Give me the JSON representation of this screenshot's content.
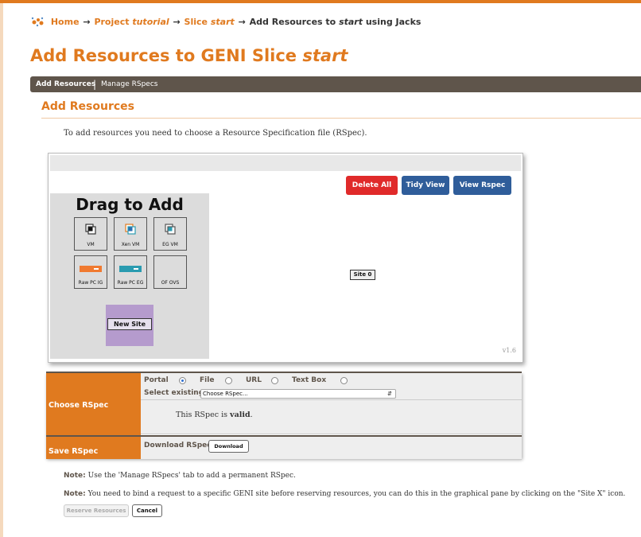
{
  "breadcrumb": {
    "home": "Home",
    "arrow": "→",
    "project_prefix": "Project",
    "project_name": "tutorial",
    "slice_prefix": "Slice",
    "slice_name": "start",
    "current_prefix": "Add Resources to",
    "current_slice": "start",
    "current_suffix": "using Jacks"
  },
  "page_title": {
    "prefix": "Add Resources to GENI Slice",
    "slice": "start"
  },
  "tabs": {
    "add": "Add Resources",
    "separator": "|",
    "manage": "Manage RSpecs"
  },
  "section_title": "Add Resources",
  "intro_text": "To add resources you need to choose a Resource Specification file (RSpec).",
  "jacks": {
    "buttons": {
      "delete_all": "Delete All",
      "tidy_view": "Tidy View",
      "view_rspec": "View Rspec"
    },
    "palette_title": "Drag to Add",
    "nodes": [
      {
        "label": "VM",
        "icon": "vm-icon"
      },
      {
        "label": "Xen VM",
        "icon": "xen-vm-icon"
      },
      {
        "label": "EG VM",
        "icon": "eg-vm-icon"
      },
      {
        "label": "Raw PC IG",
        "icon": "raw-pc-ig-icon"
      },
      {
        "label": "Raw PC EG",
        "icon": "raw-pc-eg-icon"
      },
      {
        "label": "OF OVS",
        "icon": ""
      }
    ],
    "new_site": "New Site",
    "site0": "Site 0",
    "version": "v1.6"
  },
  "form": {
    "choose_rspec": "Choose RSpec",
    "save_rspec": "Save RSpec",
    "source_options": [
      "Portal",
      "File",
      "URL",
      "Text Box"
    ],
    "selected_source_index": 0,
    "select_existing_label": "Select existing:",
    "select_value": "Choose RSpec...",
    "valid_prefix": "This RSpec is",
    "valid_word": "valid",
    "valid_suffix": ".",
    "download_label": "Download RSpec:",
    "download_button": "Download"
  },
  "notes": [
    {
      "label": "Note:",
      "text": "Use the 'Manage RSpecs' tab to add a permanent RSpec."
    },
    {
      "label": "Note:",
      "text": "You need to bind a request to a specific GENI site before reserving resources, you can do this in the graphical pane by clicking on the \"Site X\" icon."
    }
  ],
  "actions": {
    "reserve": "Reserve Resources",
    "cancel": "Cancel"
  },
  "colors": {
    "accent": "#e07a1f",
    "tabbar": "#5f554b",
    "delete": "#e02a2a",
    "primary": "#2f5d9a",
    "new_site_bg": "#b59bcd"
  }
}
